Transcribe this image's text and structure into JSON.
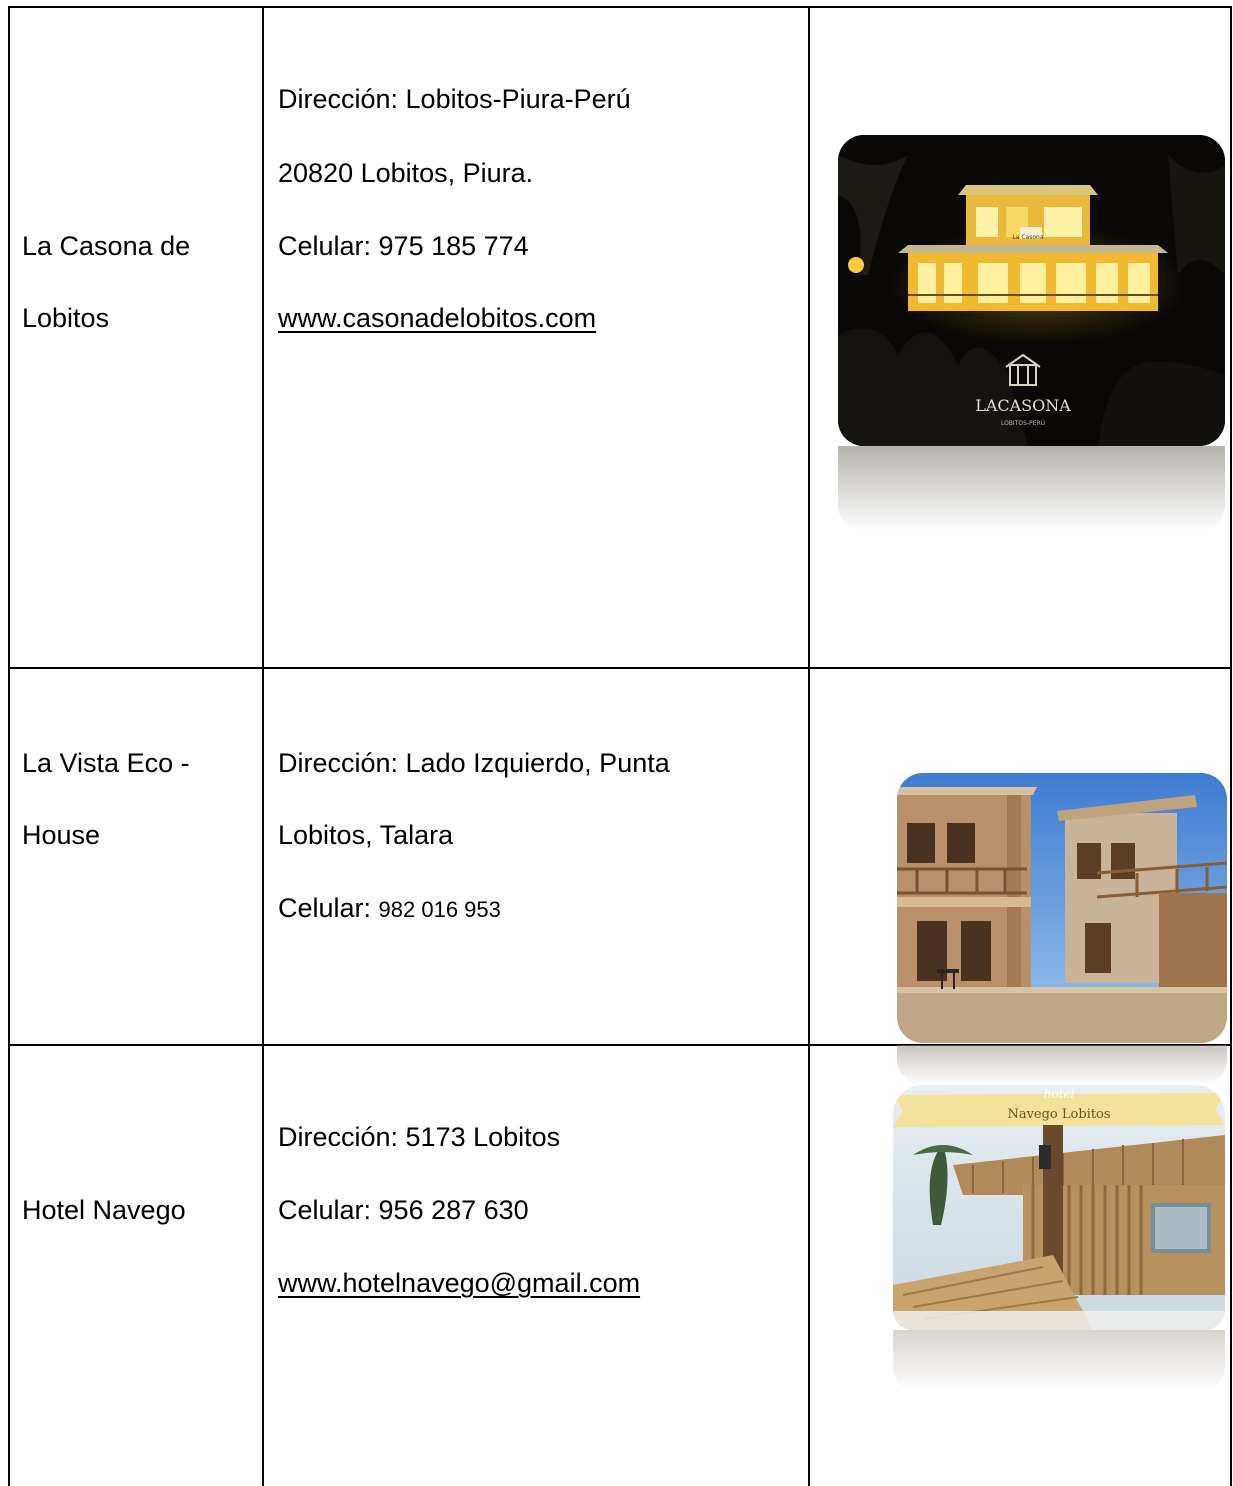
{
  "rows": [
    {
      "name": "La Casona de Lobitos",
      "name_lines": [
        "La Casona de",
        "Lobitos"
      ],
      "details": [
        {
          "label": "Dirección: Lobitos-Piura-Perú"
        },
        {
          "label": "20820 Lobitos, Piura."
        },
        {
          "label": "Celular: 975 185 774"
        },
        {
          "link": "www.casonadelobitos.com"
        }
      ],
      "image": {
        "icon": "lacasona-hotel-night-photo",
        "logo_text": "LACASONA",
        "logo_sub": "LOBITOS-PERÚ",
        "sign_text": "La Casona"
      }
    },
    {
      "name": "La Vista Eco - House",
      "name_lines": [
        "La Vista Eco -",
        "House"
      ],
      "details": [
        {
          "label": "Dirección: Lado Izquierdo, Punta"
        },
        {
          "label": "Lobitos, Talara"
        },
        {
          "label_prefix": "Celular: ",
          "label_small": "982 016 953"
        }
      ],
      "image": {
        "icon": "wooden-eco-house-photo"
      }
    },
    {
      "name": "Hotel Navego",
      "name_lines": [
        "Hotel Navego"
      ],
      "details": [
        {
          "label": "Dirección: 5173 Lobitos"
        },
        {
          "label": "Celular: 956 287 630"
        },
        {
          "link": "www.hotelnavego@gmail.com"
        }
      ],
      "image": {
        "icon": "bamboo-hotel-photo",
        "banner_small": "hotel",
        "banner": "Navego Lobitos"
      }
    }
  ],
  "colors": {
    "border": "#000000",
    "link": "#000000",
    "background": "#ffffff"
  }
}
